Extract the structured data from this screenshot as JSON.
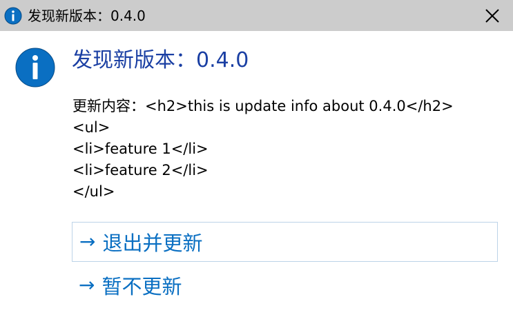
{
  "window": {
    "title": "发现新版本：0.4.0",
    "icon": "info-icon",
    "close_icon": "close-icon"
  },
  "dialog": {
    "heading": "发现新版本：0.4.0",
    "content_lines": [
      "更新内容：<h2>this is update info about 0.4.0</h2>",
      "<ul>",
      "<li>feature 1</li>",
      "<li>feature 2</li>",
      "</ul>"
    ],
    "buttons": {
      "update_arrow": "→",
      "update_label": "退出并更新",
      "skip_arrow": "→",
      "skip_label": "暂不更新"
    }
  },
  "colors": {
    "titlebar": "#cccccc",
    "heading": "#1a3fa3",
    "link": "#0a6fc2",
    "info_icon": "#0a6fc2"
  }
}
